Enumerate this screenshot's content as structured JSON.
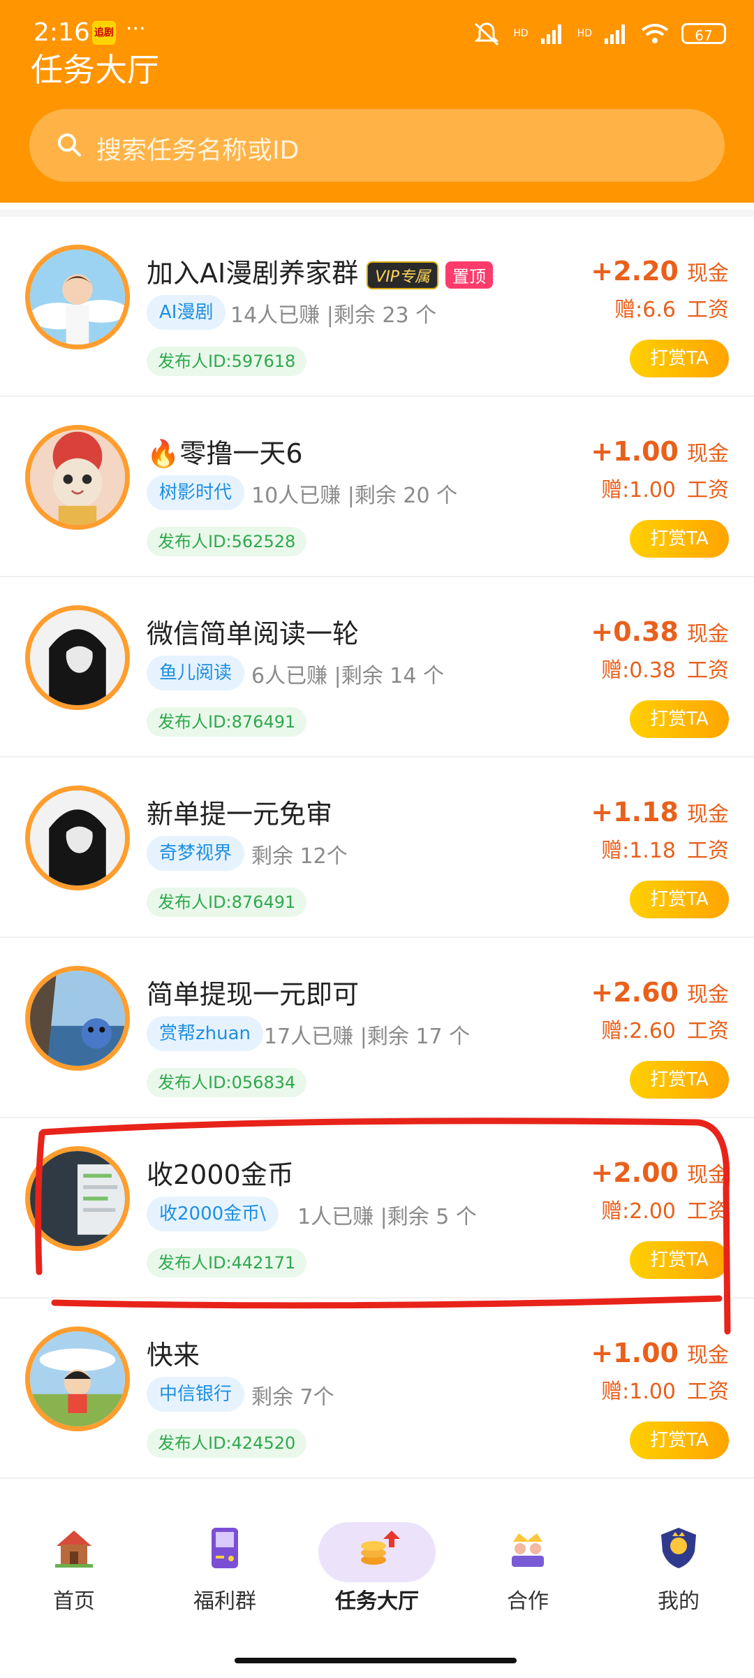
{
  "status_bar": {
    "time": "2:16",
    "app_icon_text": "追剧",
    "dots": "···",
    "signal_1": "HD",
    "signal_2": "HD",
    "battery": "67"
  },
  "header": {
    "title": "任务大厅",
    "search_placeholder": "搜索任务名称或ID"
  },
  "tasks": [
    {
      "title": "加入AI漫剧养家群",
      "badge_vip": "VIP专属",
      "badge_top": "置顶",
      "tag": "AI漫剧",
      "stats": "14人已赚 |剩余 23 个",
      "publisher": "发布人ID:597618",
      "cash": "+2.20",
      "cash_label": "现金",
      "bonus": "赠:6.6",
      "bonus_label": "工资",
      "tip": "打赏TA"
    },
    {
      "title": "🔥零撸一天6",
      "tag": "树影时代",
      "stats": "10人已赚 |剩余 20 个",
      "publisher": "发布人ID:562528",
      "cash": "+1.00",
      "cash_label": "现金",
      "bonus": "赠:1.00",
      "bonus_label": "工资",
      "tip": "打赏TA"
    },
    {
      "title": "微信简单阅读一轮",
      "tag": "鱼儿阅读",
      "stats": "6人已赚 |剩余 14 个",
      "publisher": "发布人ID:876491",
      "cash": "+0.38",
      "cash_label": "现金",
      "bonus": "赠:0.38",
      "bonus_label": "工资",
      "tip": "打赏TA"
    },
    {
      "title": "新单提一元免审",
      "tag": "奇梦视界",
      "stats": "剩余 12个",
      "publisher": "发布人ID:876491",
      "cash": "+1.18",
      "cash_label": "现金",
      "bonus": "赠:1.18",
      "bonus_label": "工资",
      "tip": "打赏TA"
    },
    {
      "title": "简单提现一元即可",
      "tag": "赏帮zhuan",
      "stats": "17人已赚 |剩余 17 个",
      "publisher": "发布人ID:056834",
      "cash": "+2.60",
      "cash_label": "现金",
      "bonus": "赠:2.60",
      "bonus_label": "工资",
      "tip": "打赏TA"
    },
    {
      "title": "收2000金币",
      "tag": "收2000金币\\",
      "stats": "1人已赚 |剩余 5 个",
      "publisher": "发布人ID:442171",
      "cash": "+2.00",
      "cash_label": "现金",
      "bonus": "赠:2.00",
      "bonus_label": "工资",
      "tip": "打赏TA"
    },
    {
      "title": "快来",
      "tag": "中信银行",
      "stats": "剩余 7个",
      "publisher": "发布人ID:424520",
      "cash": "+1.00",
      "cash_label": "现金",
      "bonus": "赠:1.00",
      "bonus_label": "工资",
      "tip": "打赏TA"
    }
  ],
  "tabbar": {
    "home": "首页",
    "welfare": "福利群",
    "tasks": "任务大厅",
    "partner": "合作",
    "me": "我的"
  },
  "colors": {
    "brand_orange": "#ff9500",
    "reward_red": "#e8601c",
    "annotation_red": "#e8231a"
  }
}
